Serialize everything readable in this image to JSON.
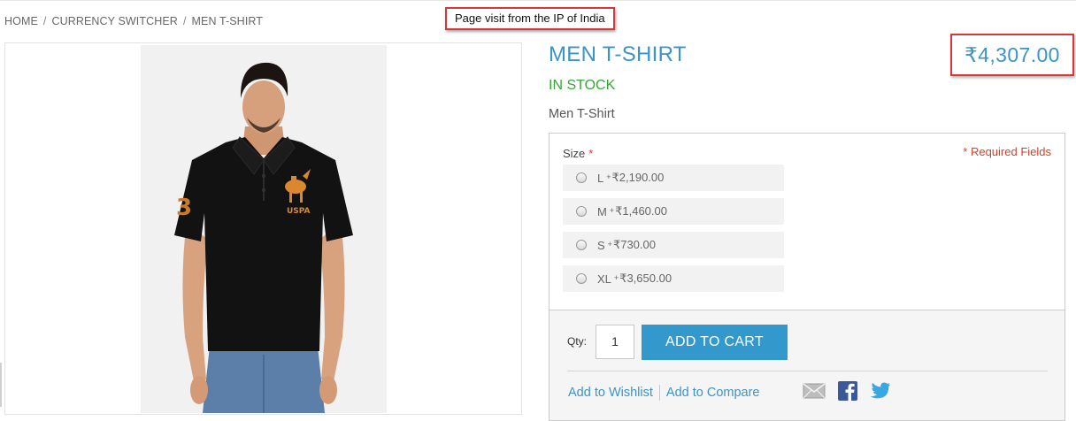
{
  "breadcrumb": {
    "home": "HOME",
    "separator": "/",
    "currency": "CURRENCY SWITCHER",
    "current": "MEN T-SHIRT"
  },
  "callout": "Page visit from the IP of India",
  "product": {
    "title": "MEN T-SHIRT",
    "stock": "IN STOCK",
    "price": "₹4,307.00",
    "short_description": "Men T-Shirt",
    "image_logo_text": "USPA"
  },
  "options": {
    "size_label": "Size",
    "asterisk": "*",
    "required_note": "* Required Fields",
    "plus": "+",
    "sizes": [
      {
        "name": "L",
        "price": "₹2,190.00"
      },
      {
        "name": "M",
        "price": "₹1,460.00"
      },
      {
        "name": "S",
        "price": "₹730.00"
      },
      {
        "name": "XL",
        "price": "₹3,650.00"
      }
    ]
  },
  "cart": {
    "qty_label": "Qty:",
    "qty_value": "1",
    "add_label": "ADD TO CART",
    "wishlist": "Add to Wishlist",
    "compare": "Add to Compare"
  },
  "colors": {
    "accent": "#3b94c6",
    "button": "#3399cc",
    "in_stock": "#3aa33a",
    "required": "#c8452f",
    "highlight_border": "#d23a3a"
  },
  "icons": {
    "email": "email-icon",
    "facebook": "facebook-icon",
    "twitter": "twitter-icon"
  }
}
